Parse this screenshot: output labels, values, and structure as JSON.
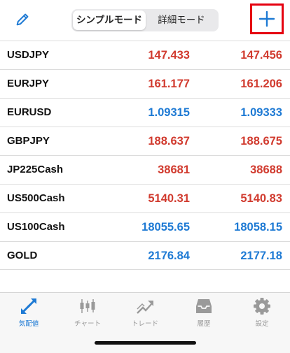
{
  "header": {
    "mode_simple": "シンプルモード",
    "mode_detail": "詳細モード",
    "accent_color": "#1e7ad4",
    "highlight_color": "#e5000f"
  },
  "quotes": [
    {
      "symbol": "USDJPY",
      "bid": "147.433",
      "ask": "147.456",
      "color": "red"
    },
    {
      "symbol": "EURJPY",
      "bid": "161.177",
      "ask": "161.206",
      "color": "red"
    },
    {
      "symbol": "EURUSD",
      "bid": "1.09315",
      "ask": "1.09333",
      "color": "blue"
    },
    {
      "symbol": "GBPJPY",
      "bid": "188.637",
      "ask": "188.675",
      "color": "red"
    },
    {
      "symbol": "JP225Cash",
      "bid": "38681",
      "ask": "38688",
      "color": "red"
    },
    {
      "symbol": "US500Cash",
      "bid": "5140.31",
      "ask": "5140.83",
      "color": "red"
    },
    {
      "symbol": "US100Cash",
      "bid": "18055.65",
      "ask": "18058.15",
      "color": "blue"
    },
    {
      "symbol": "GOLD",
      "bid": "2176.84",
      "ask": "2177.18",
      "color": "blue"
    }
  ],
  "tabs": [
    {
      "label": "気配値",
      "icon": "quotes-icon",
      "active": true
    },
    {
      "label": "チャート",
      "icon": "chart-icon",
      "active": false
    },
    {
      "label": "トレード",
      "icon": "trade-icon",
      "active": false
    },
    {
      "label": "履歴",
      "icon": "history-icon",
      "active": false
    },
    {
      "label": "設定",
      "icon": "settings-icon",
      "active": false
    }
  ]
}
